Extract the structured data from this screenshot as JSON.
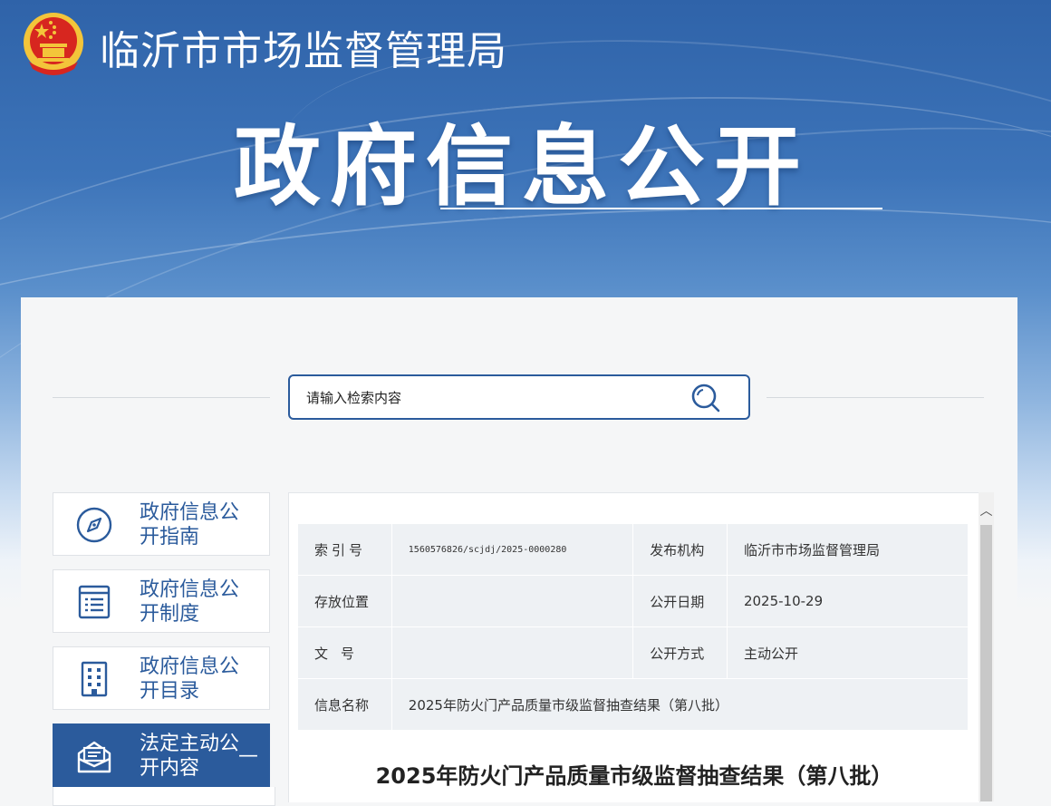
{
  "header": {
    "org_name": "临沂市市场监督管理局",
    "hero_title": "政府信息公开"
  },
  "search": {
    "placeholder": "请输入检索内容"
  },
  "sidebar": {
    "items": [
      {
        "label": "政府信息公开指南",
        "icon": "compass-icon"
      },
      {
        "label": "政府信息公开制度",
        "icon": "document-list-icon"
      },
      {
        "label": "政府信息公开目录",
        "icon": "directory-icon"
      },
      {
        "label": "法定主动公开内容",
        "icon": "open-envelope-icon",
        "active": true,
        "expand_symbol": "—"
      }
    ]
  },
  "meta": {
    "index_no_label": "索引号",
    "index_no": "1560576826/scjdj/2025-0000280",
    "publisher_label": "发布机构",
    "publisher": "临沂市市场监督管理局",
    "location_label": "存放位置",
    "location": "",
    "date_label": "公开日期",
    "date": "2025-10-29",
    "doc_no_label": "文号",
    "doc_no": "",
    "method_label": "公开方式",
    "method": "主动公开",
    "name_label": "信息名称",
    "name": "2025年防火门产品质量市级监督抽查结果（第八批）"
  },
  "document": {
    "title": "2025年防火门产品质量市级监督抽查结果（第八批）"
  },
  "colors": {
    "brand_blue": "#2b5b9c",
    "emblem_red": "#d7261f",
    "emblem_gold": "#f3c53a"
  }
}
